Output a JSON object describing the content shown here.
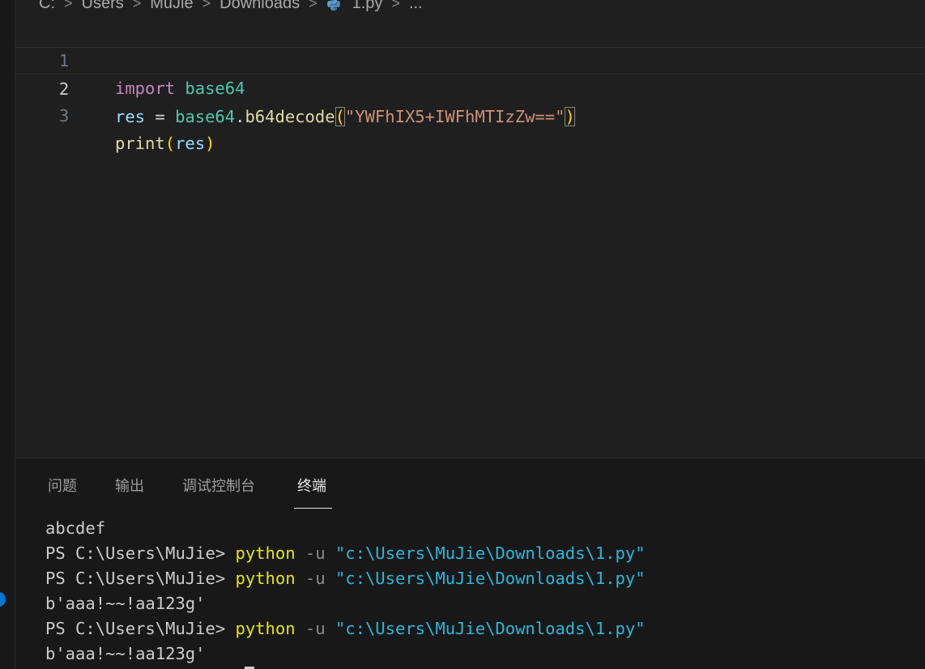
{
  "breadcrumb": {
    "items": [
      "C:",
      "Users",
      "MuJie",
      "Downloads",
      "1.py",
      "..."
    ],
    "separator": ">"
  },
  "editor": {
    "line_numbers": [
      "1",
      "2",
      "3"
    ],
    "active_line": 2,
    "lines": [
      {
        "t1": "import",
        "t2": " ",
        "t3": "base64"
      },
      {
        "t1": "res",
        "t2": " = ",
        "t3": "base64",
        "t4": ".",
        "t5": "b64decode",
        "t6": "(",
        "t7": "\"YWFhIX5+IWFhMTIzZw==\"",
        "t8": ")"
      },
      {
        "t1": "print",
        "t2": "(",
        "t3": "res",
        "t4": ")"
      }
    ]
  },
  "panel": {
    "tabs": [
      "问题",
      "输出",
      "调试控制台",
      "终端"
    ],
    "active_tab": "终端"
  },
  "terminal": {
    "lines": [
      {
        "type": "out",
        "text": "abcdef"
      },
      {
        "type": "cmd",
        "prompt": "PS C:\\Users\\MuJie> ",
        "cmd": "python",
        "flag": " -u ",
        "arg": "\"c:\\Users\\MuJie\\Downloads\\1.py\""
      },
      {
        "type": "cmd",
        "prompt": "PS C:\\Users\\MuJie> ",
        "cmd": "python",
        "flag": " -u ",
        "arg": "\"c:\\Users\\MuJie\\Downloads\\1.py\""
      },
      {
        "type": "out",
        "text": "b'aaa!~~!aa123g'"
      },
      {
        "type": "cmd",
        "prompt": "PS C:\\Users\\MuJie> ",
        "cmd": "python",
        "flag": " -u ",
        "arg": "\"c:\\Users\\MuJie\\Downloads\\1.py\""
      },
      {
        "type": "out",
        "text": "b'aaa!~~!aa123g'"
      }
    ]
  },
  "colors": {
    "background": "#1f1f1f",
    "panel": "#181818",
    "keyword": "#c586c0",
    "module": "#4ec9b0",
    "variable": "#9cdcfe",
    "function": "#dcdcaa",
    "string": "#ce9178",
    "bracket": "#ffd700",
    "terminal_command": "#e5e510",
    "terminal_string": "#29b8db"
  }
}
